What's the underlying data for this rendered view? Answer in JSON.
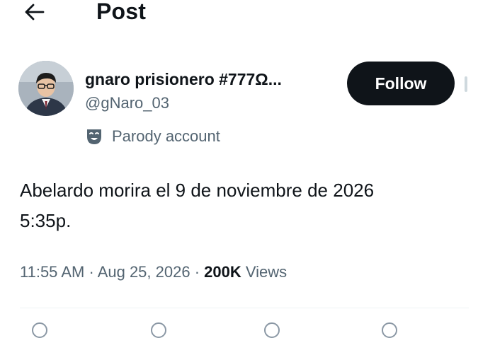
{
  "header": {
    "title": "Post",
    "back_icon": "arrow-left-icon"
  },
  "author": {
    "display_name": "gnaro prisionero #777Ω...",
    "handle": "@gNaro_03",
    "parody_label": "Parody account",
    "parody_icon": "theater-mask-icon"
  },
  "follow_button": {
    "label": "Follow"
  },
  "tweet": {
    "text_line1": "Abelardo morira el 9 de noviembre de 2026",
    "text_line2": "5:35p."
  },
  "meta": {
    "time": "11:55 AM",
    "separator": "·",
    "date": "Aug 25, 2026",
    "views_count": "200K",
    "views_label": "Views"
  },
  "colors": {
    "text": "#0f1419",
    "secondary": "#536471",
    "button_bg": "#0f1419",
    "button_text": "#ffffff",
    "divider": "#eff3f4"
  },
  "actions": [
    "reply-icon",
    "repost-icon",
    "like-icon",
    "views-icon"
  ]
}
